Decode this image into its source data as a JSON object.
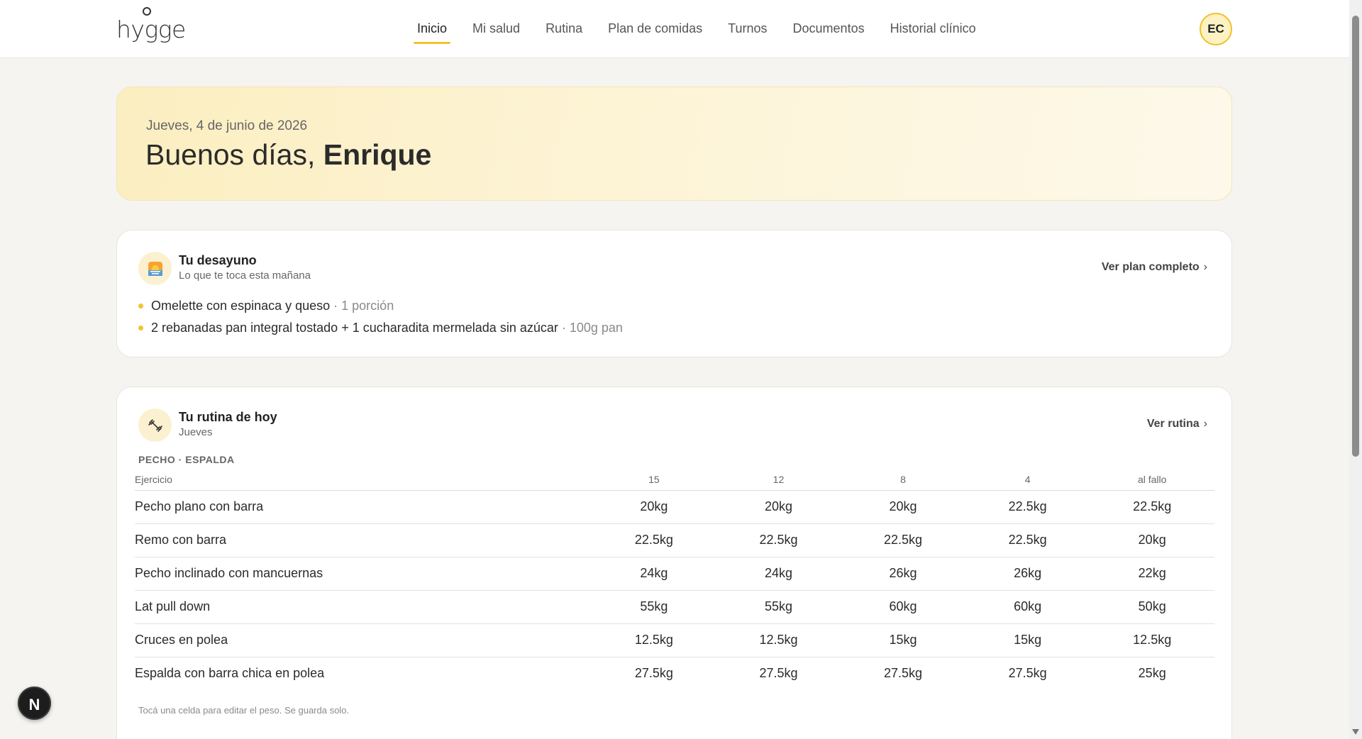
{
  "brand": {
    "name": "hygge"
  },
  "nav": {
    "items": [
      {
        "label": "Inicio",
        "active": true
      },
      {
        "label": "Mi salud"
      },
      {
        "label": "Rutina"
      },
      {
        "label": "Plan de comidas"
      },
      {
        "label": "Turnos"
      },
      {
        "label": "Documentos"
      },
      {
        "label": "Historial clínico"
      }
    ],
    "avatar_initials": "EC"
  },
  "hero": {
    "date": "Jueves, 4 de junio de 2026",
    "greeting": "Buenos días, ",
    "name": "Enrique"
  },
  "breakfast": {
    "title": "Tu desayuno",
    "subtitle": "Lo que te toca esta mañana",
    "link": "Ver plan completo",
    "icon": "sunrise-icon",
    "items": [
      {
        "text": "Omelette con espinaca y queso",
        "qty": " · 1 porción"
      },
      {
        "text": "2 rebanadas pan integral tostado + 1 cucharadita mermelada sin azúcar",
        "qty": " · 100g pan"
      }
    ]
  },
  "routine": {
    "title": "Tu rutina de hoy",
    "subtitle": "Jueves",
    "link": "Ver rutina",
    "icon": "dumbbell-icon",
    "group": "PECHO · ESPALDA",
    "columns": [
      "Ejercicio",
      "15",
      "12",
      "8",
      "4",
      "al fallo"
    ],
    "rows": [
      {
        "exercise": "Pecho plano con barra",
        "weights": [
          "20kg",
          "20kg",
          "20kg",
          "22.5kg",
          "22.5kg"
        ]
      },
      {
        "exercise": "Remo con barra",
        "weights": [
          "22.5kg",
          "22.5kg",
          "22.5kg",
          "22.5kg",
          "20kg"
        ]
      },
      {
        "exercise": "Pecho inclinado con mancuernas",
        "weights": [
          "24kg",
          "24kg",
          "26kg",
          "26kg",
          "22kg"
        ]
      },
      {
        "exercise": "Lat pull down",
        "weights": [
          "55kg",
          "55kg",
          "60kg",
          "60kg",
          "50kg"
        ]
      },
      {
        "exercise": "Cruces en polea",
        "weights": [
          "12.5kg",
          "12.5kg",
          "15kg",
          "15kg",
          "12.5kg"
        ]
      },
      {
        "exercise": "Espalda con barra chica en polea",
        "weights": [
          "27.5kg",
          "27.5kg",
          "27.5kg",
          "27.5kg",
          "25kg"
        ]
      }
    ],
    "hint": "Tocá una celda para editar el peso. Se guarda solo."
  },
  "fab": {
    "label": "N"
  },
  "colors": {
    "accent": "#f2c230",
    "background": "#f5f4f1",
    "hero": "#fbeec0"
  }
}
